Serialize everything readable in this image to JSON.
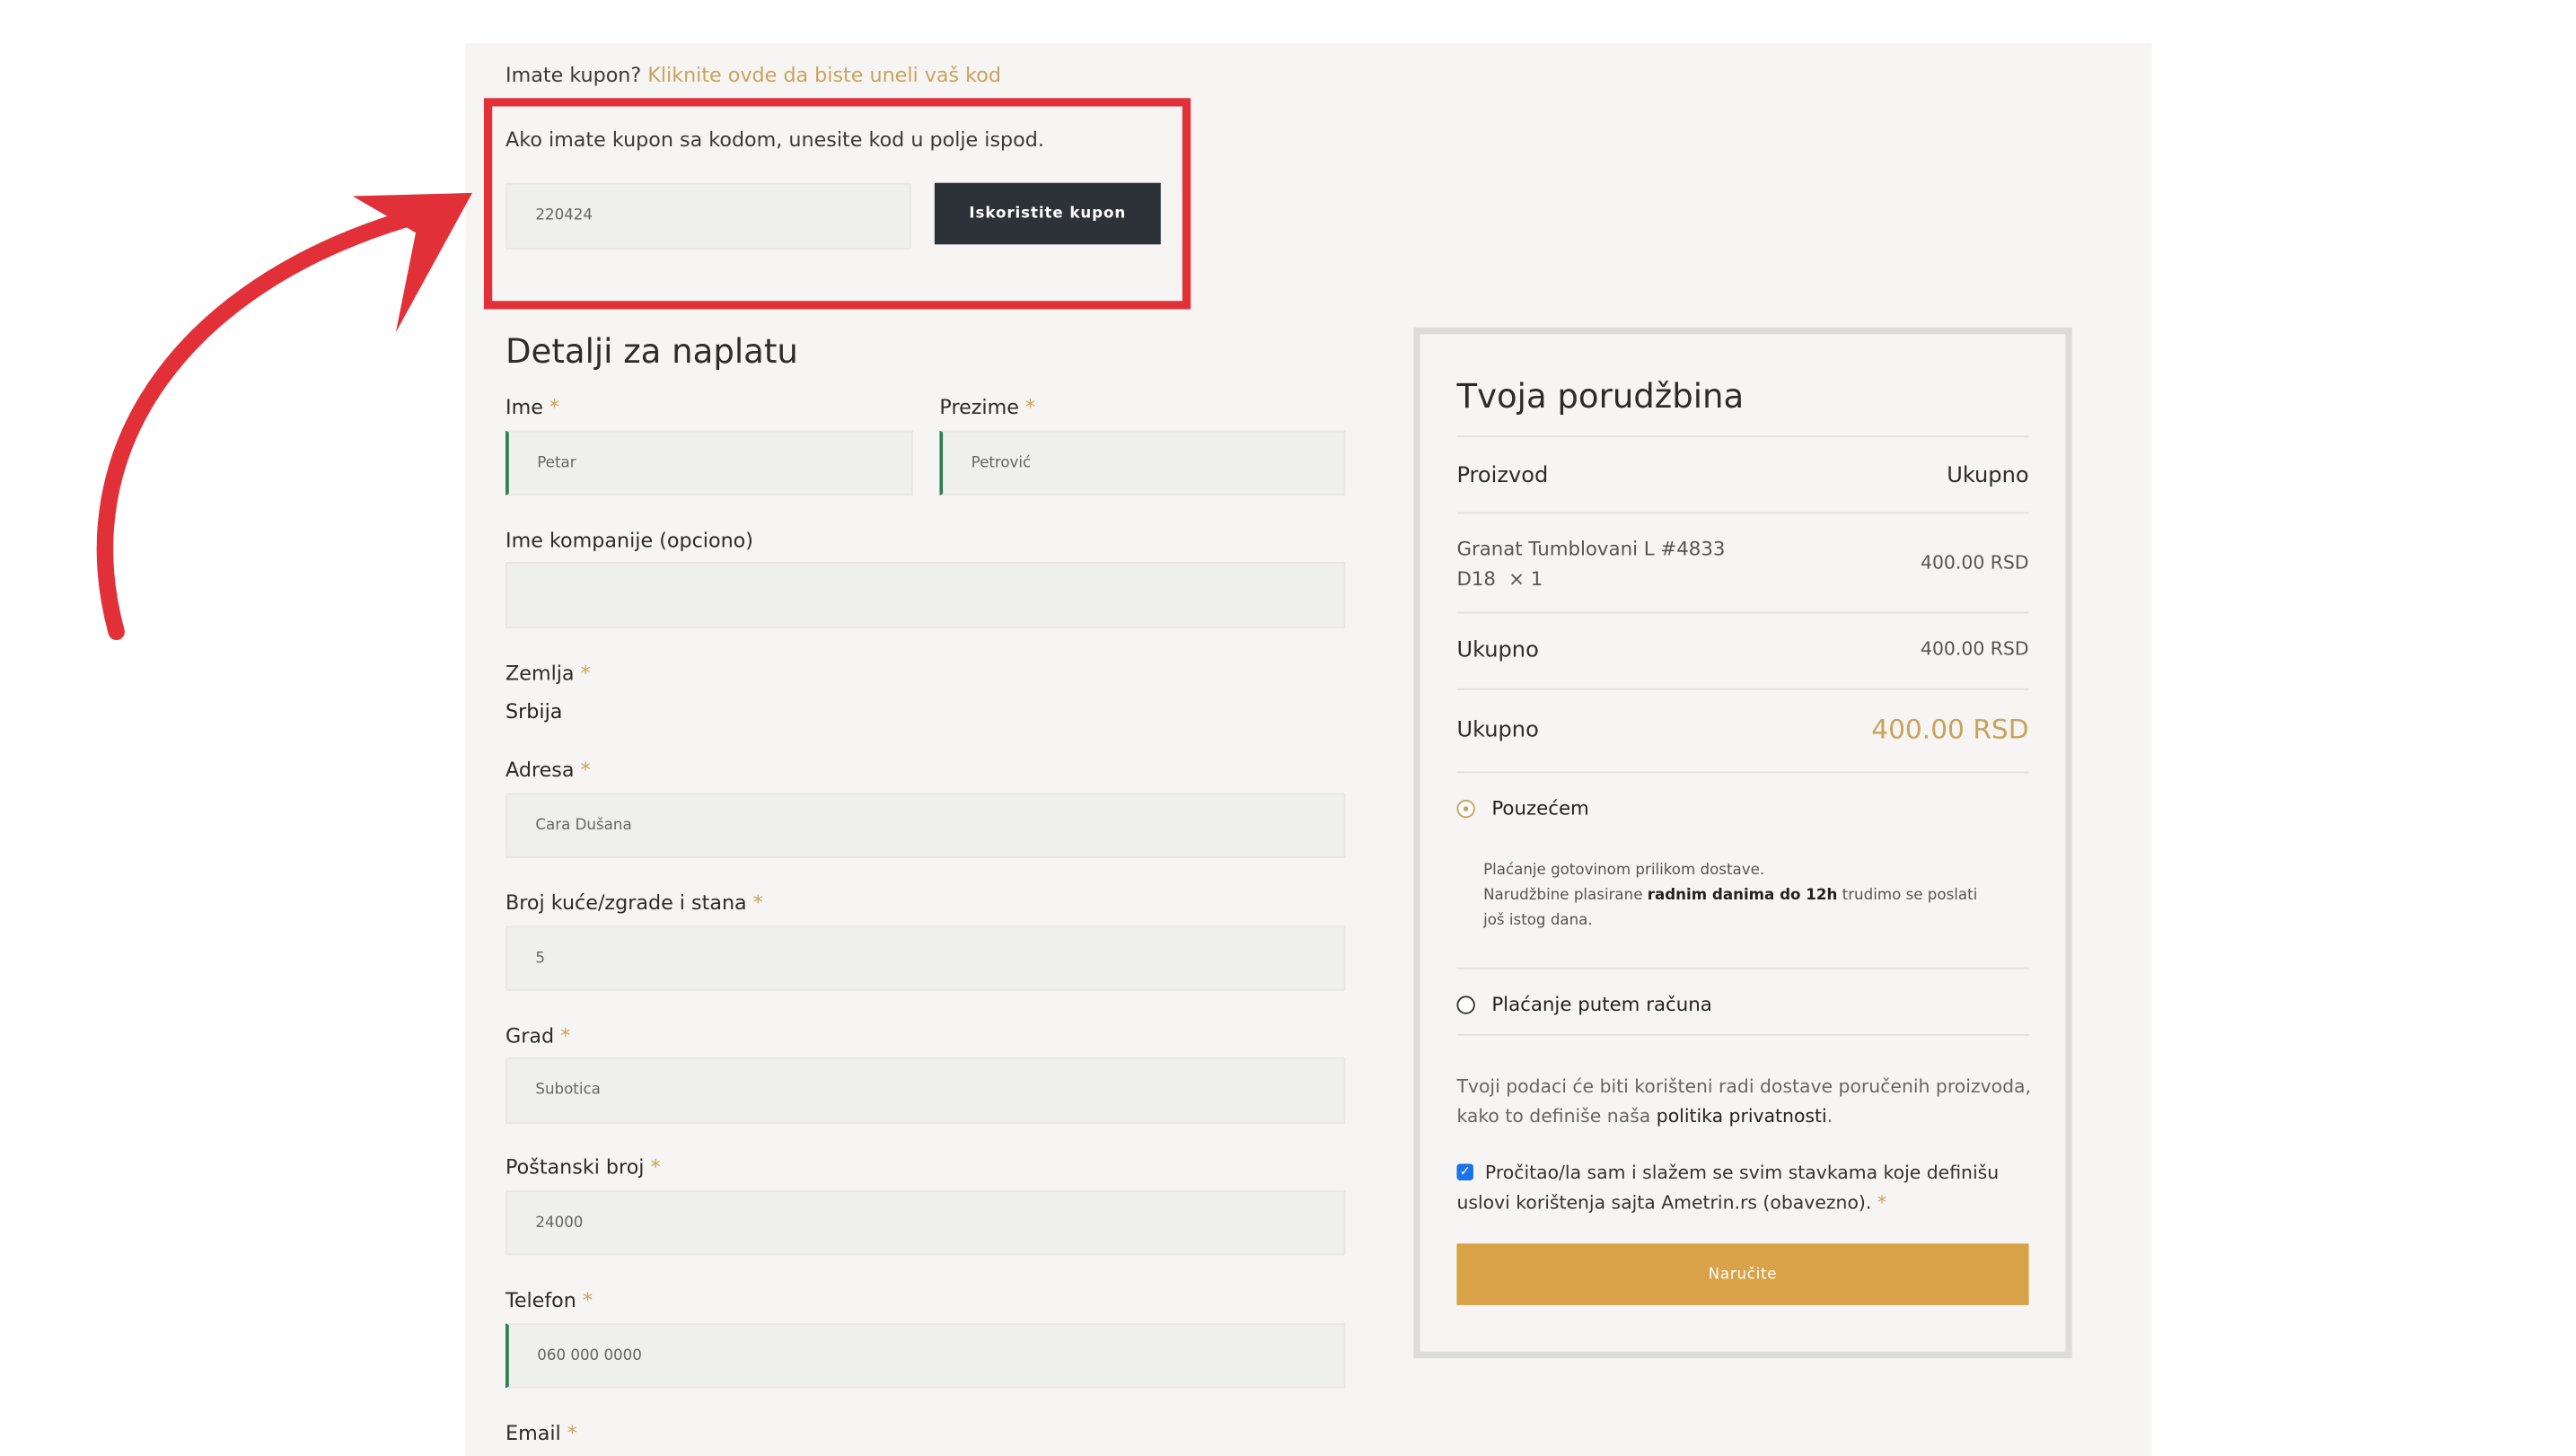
{
  "coupon": {
    "prompt": "Imate kupon?",
    "link": "Kliknite ovde da biste uneli vaš kod",
    "hint": "Ako imate kupon sa kodom, unesite kod u polje ispod.",
    "code_value": "220424",
    "apply_button": "Iskoristite kupon"
  },
  "billing": {
    "title": "Detalji za naplatu",
    "required_mark": "*",
    "first_name": {
      "label": "Ime",
      "value": "Petar"
    },
    "last_name": {
      "label": "Prezime",
      "value": "Petrović"
    },
    "company": {
      "label": "Ime kompanije (opciono)",
      "value": ""
    },
    "country": {
      "label": "Zemlja",
      "value": "Srbija"
    },
    "address": {
      "label": "Adresa",
      "value": "Cara Dušana"
    },
    "house_number": {
      "label": "Broj kuće/zgrade i stana",
      "value": "5"
    },
    "city": {
      "label": "Grad",
      "value": "Subotica"
    },
    "postal_code": {
      "label": "Poštanski broj",
      "value": "24000"
    },
    "phone": {
      "label": "Telefon",
      "value": "060 000 0000"
    },
    "email": {
      "label": "Email"
    }
  },
  "order": {
    "title": "Tvoja porudžbina",
    "col_product": "Proizvod",
    "col_total": "Ukupno",
    "item_name_line1": "Granat Tumblovani L #4833",
    "item_name_line2": "D18",
    "item_qty": "× 1",
    "item_price": "400.00 RSD",
    "subtotal_label": "Ukupno",
    "subtotal_value": "400.00 RSD",
    "total_label": "Ukupno",
    "total_value": "400.00 RSD",
    "payment_cod": "Pouzećem",
    "cod_desc_line1": "Plaćanje gotovinom prilikom dostave.",
    "cod_desc_line2_pre": "Narudžbine plasirane ",
    "cod_desc_line2_bold": "radnim danima do 12h",
    "cod_desc_line2_post": " trudimo se poslati",
    "cod_desc_line3": "još istog dana.",
    "payment_invoice": "Plaćanje putem računa",
    "privacy_line1": "Tvoji podaci će biti korišteni radi dostave poručenih proizvoda,",
    "privacy_line2_pre": "kako to definiše naša ",
    "privacy_link": "politika privatnosti",
    "privacy_line2_post": ".",
    "terms_line1": "Pročitao/la sam i slažem se svim stavkama koje definišu",
    "terms_line2": "uslovi korištenja sajta Ametrin.rs (obavezno).",
    "place_order": "Naručite"
  },
  "colors": {
    "accent_gold": "#d9a248",
    "annotation_red": "#e23038",
    "button_dark": "#2d3238"
  }
}
